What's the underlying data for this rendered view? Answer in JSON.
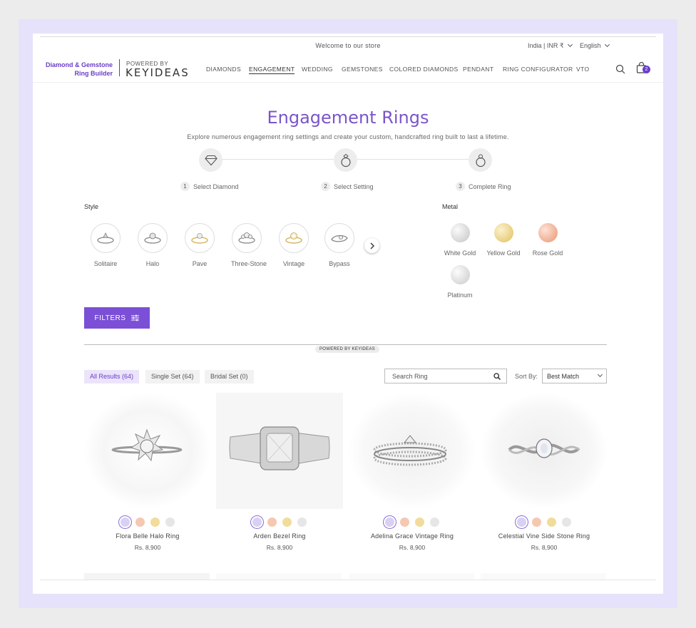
{
  "header": {
    "welcome": "Welcome to our store",
    "currency": "India | INR ₹",
    "language": "English",
    "brand_line1": "Diamond & Gemstone",
    "brand_line2": "Ring Builder",
    "powered_by": "POWERED BY",
    "logo_text": "KEYIDEAS",
    "nav": [
      "DIAMONDS",
      "ENGAGEMENT",
      "WEDDING",
      "GEMSTONES",
      "COLORED DIAMONDS",
      "PENDANT",
      "RING CONFIGURATOR",
      "VTO"
    ],
    "active_nav": "ENGAGEMENT",
    "cart_count": "2",
    "search_icon": "search-icon",
    "cart_icon": "shopping-bag-icon"
  },
  "hero": {
    "title": "Engagement Rings",
    "subtitle": "Explore numerous engagement ring settings and create your custom, handcrafted ring built to last a lifetime."
  },
  "steps": [
    {
      "num": "1",
      "label": "Select Diamond",
      "icon": "diamond-icon"
    },
    {
      "num": "2",
      "label": "Select Setting",
      "icon": "ring-setting-icon"
    },
    {
      "num": "3",
      "label": "Complete Ring",
      "icon": "complete-ring-icon"
    }
  ],
  "style": {
    "label": "Style",
    "options": [
      "Solitaire",
      "Halo",
      "Pave",
      "Three-Stone",
      "Vintage",
      "Bypass"
    ]
  },
  "metal": {
    "label": "Metal",
    "options": [
      {
        "name": "White Gold",
        "color": "#e0e0e0"
      },
      {
        "name": "Yellow Gold",
        "color": "#f0dc96"
      },
      {
        "name": "Rose Gold",
        "color": "#f5bfa6"
      },
      {
        "name": "Platinum",
        "color": "#e4e4e4"
      }
    ]
  },
  "filters_label": "FILTERS",
  "powered_badge": "POWERED BY KEYIDEAS",
  "tabs": [
    {
      "label": "All Results (64)",
      "active": true
    },
    {
      "label": "Single Set (64)",
      "active": false
    },
    {
      "label": "Bridal Set (0)",
      "active": false
    }
  ],
  "search": {
    "placeholder": "Search Ring"
  },
  "sort": {
    "label": "Sort By:",
    "value": "Best Match"
  },
  "swatch_colors": [
    "#d9d1f3",
    "#f5c8b1",
    "#f2dc9c",
    "#e6e6e6"
  ],
  "products": [
    {
      "name": "Flora Belle Halo Ring",
      "price": "Rs. 8,900"
    },
    {
      "name": "Arden Bezel Ring",
      "price": "Rs. 8,900"
    },
    {
      "name": "Adelina Grace Vintage Ring",
      "price": "Rs. 8,900"
    },
    {
      "name": "Celestial Vine Side Stone Ring",
      "price": "Rs. 8,900"
    }
  ],
  "colors": {
    "accent": "#7b4fd6",
    "title": "#7a55c9",
    "frame": "#e7e2fb"
  }
}
